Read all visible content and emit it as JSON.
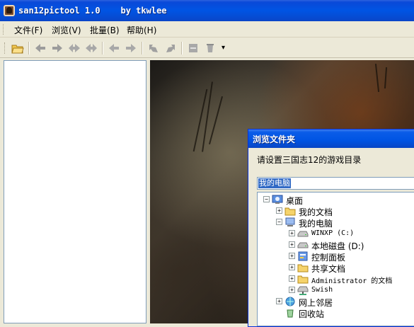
{
  "window": {
    "title": "san12pictool 1.0    by tkwlee"
  },
  "menu": [
    {
      "label": "文件(F)"
    },
    {
      "label": "浏览(V)"
    },
    {
      "label": "批量(B)"
    },
    {
      "label": "帮助(H)"
    }
  ],
  "toolbar": {
    "buttons": [
      {
        "icon": "open-folder-icon"
      },
      {
        "icon": "arrow-left-icon"
      },
      {
        "icon": "arrow-right-icon"
      },
      {
        "icon": "first-icon"
      },
      {
        "icon": "last-icon"
      },
      {
        "icon": "prev-icon"
      },
      {
        "icon": "next-icon"
      },
      {
        "icon": "rotate-left-icon"
      },
      {
        "icon": "rotate-right-icon"
      },
      {
        "icon": "save-icon"
      },
      {
        "icon": "delete-icon"
      }
    ],
    "more": "▾"
  },
  "dialog": {
    "title": "浏览文件夹",
    "prompt": "请设置三国志12的游戏目录",
    "selected_path": "我的电脑",
    "tree": [
      {
        "label": "桌面",
        "depth": 0,
        "expander": "−",
        "icon": "desktop-icon",
        "mono": false
      },
      {
        "label": "我的文档",
        "depth": 1,
        "expander": "+",
        "icon": "folder-icon",
        "mono": false
      },
      {
        "label": "我的电脑",
        "depth": 1,
        "expander": "−",
        "icon": "computer-icon",
        "mono": false
      },
      {
        "label": "WINXP (C:)",
        "depth": 2,
        "expander": "+",
        "icon": "drive-icon",
        "mono": true
      },
      {
        "label": "本地磁盘 (D:)",
        "depth": 2,
        "expander": "+",
        "icon": "drive-icon",
        "mono": false
      },
      {
        "label": "控制面板",
        "depth": 2,
        "expander": "+",
        "icon": "control-panel-icon",
        "mono": false
      },
      {
        "label": "共享文档",
        "depth": 2,
        "expander": "+",
        "icon": "folder-icon",
        "mono": false
      },
      {
        "label": "Administrator 的文档",
        "depth": 2,
        "expander": "+",
        "icon": "folder-icon",
        "mono": true
      },
      {
        "label": "Swish",
        "depth": 2,
        "expander": "+",
        "icon": "network-drive-icon",
        "mono": true
      },
      {
        "label": "网上邻居",
        "depth": 1,
        "expander": "+",
        "icon": "network-icon",
        "mono": false
      },
      {
        "label": "回收站",
        "depth": 1,
        "expander": "",
        "icon": "recycle-bin-icon",
        "mono": false
      }
    ]
  }
}
